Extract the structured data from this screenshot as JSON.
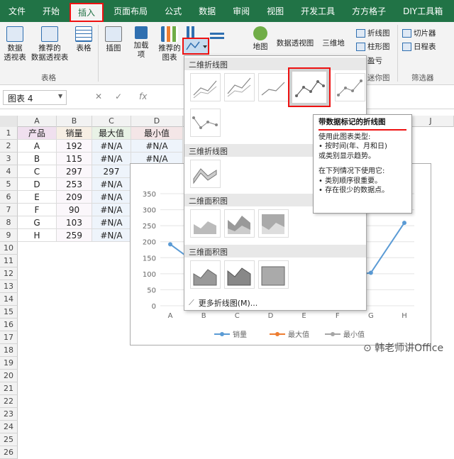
{
  "menubar": {
    "tabs": [
      "文件",
      "开始",
      "插入",
      "页面布局",
      "公式",
      "数据",
      "审阅",
      "视图",
      "开发工具",
      "方方格子",
      "DIY工具箱"
    ]
  },
  "ribbon": {
    "pivot_table": "数据\n透视表",
    "recommended_pivot": "推荐的\n数据透视表",
    "table": "表格",
    "group_tables": "表格",
    "illustrations": "插图",
    "addins": "加载\n项",
    "recommended_charts": "推荐的\n图表",
    "map": "地图",
    "pivot_chart": "数据透视图",
    "three_d": "三维地",
    "sparkline_line": "折线图",
    "sparkline_column": "柱形图",
    "sparkline_winloss": "盈亏",
    "group_sparklines": "迷你图",
    "slicer": "切片器",
    "timeline": "日程表",
    "group_filters": "筛选器"
  },
  "formula_bar": {
    "name_box": "图表 4",
    "cancel": "✕",
    "confirm": "✓",
    "fx": "fx"
  },
  "columns": [
    "A",
    "B",
    "C",
    "D",
    "J"
  ],
  "rows": [
    "1",
    "2",
    "3",
    "4",
    "5",
    "6",
    "7",
    "8",
    "9",
    "10",
    "11",
    "12",
    "13",
    "14",
    "15",
    "16",
    "17",
    "18",
    "19",
    "20",
    "21",
    "22",
    "23",
    "24",
    "25",
    "26"
  ],
  "sheet": {
    "headers": [
      "产品",
      "销量",
      "最大值",
      "最小值"
    ],
    "data": [
      [
        "A",
        "192",
        "#N/A",
        "#N/A"
      ],
      [
        "B",
        "115",
        "#N/A",
        "#N/A"
      ],
      [
        "C",
        "297",
        "297",
        "#N/A"
      ],
      [
        "D",
        "253",
        "#N/A",
        "#N/A"
      ],
      [
        "E",
        "209",
        "#N/A",
        "#N/A"
      ],
      [
        "F",
        "90",
        "#N/A",
        "#N/A"
      ],
      [
        "G",
        "103",
        "#N/A",
        "#N/A"
      ],
      [
        "H",
        "259",
        "#N/A",
        "#N/A"
      ]
    ]
  },
  "gallery": {
    "section_2d_line": "二维折线图",
    "section_3d_line": "三维折线图",
    "section_2d_area": "二维面积图",
    "section_3d_area": "三维面积图",
    "more": "更多折线图(M)..."
  },
  "tooltip": {
    "title": "带数据标记的折线图",
    "line1": "使用此图表类型:",
    "line2": "• 按时间(年、月和日)",
    "line3": "或类别显示趋势。",
    "line4": "在下列情况下使用它:",
    "line5": "• 类别顺序很重要。",
    "line6": "• 存在很少的数据点。"
  },
  "chart_data": {
    "type": "line",
    "categories": [
      "A",
      "B",
      "C",
      "D",
      "E",
      "F",
      "G",
      "H"
    ],
    "series": [
      {
        "name": "销量",
        "values": [
          192,
          115,
          297,
          253,
          209,
          90,
          103,
          259
        ],
        "color": "#5b9bd5"
      },
      {
        "name": "最大值",
        "values": [
          null,
          null,
          297,
          null,
          null,
          null,
          null,
          null
        ],
        "color": "#ed7d31"
      },
      {
        "name": "最小值",
        "values": [
          null,
          null,
          null,
          null,
          null,
          null,
          null,
          null
        ],
        "color": "#a5a5a5"
      }
    ],
    "yticks": [
      "350",
      "300",
      "250",
      "200",
      "150",
      "100",
      "50",
      "0"
    ],
    "ylim": [
      0,
      350
    ],
    "legend": "bottom"
  },
  "watermark": "韩老师讲Office",
  "colors": {
    "accent": "#217346",
    "highlight": "#e11",
    "series1": "#5b9bd5"
  }
}
